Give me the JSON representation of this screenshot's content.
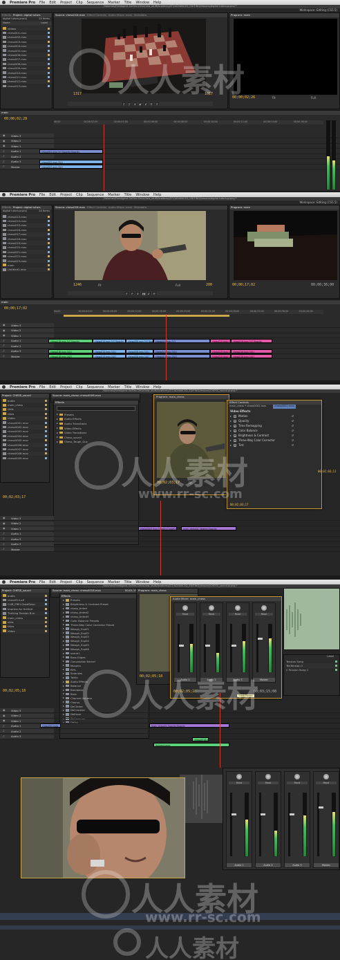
{
  "menu": {
    "apple_icon": "apple-icon",
    "app": "Premiere Pro",
    "items": [
      "File",
      "Edit",
      "Project",
      "Clip",
      "Sequence",
      "Marker",
      "Title",
      "Window",
      "Help"
    ]
  },
  "workspace": "Workspace:",
  "workspace_value": "Editing (CS5.5)",
  "s1": {
    "path": "/Volumes/FreeAgent GoFlex Drive/raw_stuff/Academy/DT/ADVANCED_EDITING/lessons/digital tutors.prproj *",
    "project_tabs": [
      "Effects",
      "Project: digital tutors"
    ],
    "project_name": "digital tutors.prproj",
    "items_count": "24 Items",
    "columns": [
      "Name",
      "Label"
    ],
    "files": [
      "videos",
      "chess001.mov",
      "chess002.mov",
      "chess003.mov",
      "chess004.mov",
      "chess005.mov",
      "chess006.mov",
      "chess007.mov",
      "chess008.mov",
      "chess009.mov",
      "chess010.mov",
      "chess011.mov",
      "chess012.mov",
      "chess013.mov"
    ],
    "source_tabs": [
      "Source: chess018.mov",
      "Effect Controls",
      "Audio Mixer: main",
      "Metadata"
    ],
    "program_tab": "Program: main",
    "source_tc_in": "1317",
    "source_tc_out": "1017",
    "program_tc": "00;00;02;26",
    "fit": "Fit",
    "full": "Full",
    "seq_tab": "main",
    "seq_tc": "00;00;02;28",
    "ruler": [
      "00;00",
      "00;00;02;00",
      "00;00;04;00",
      "00;00;06;00",
      "00;00;08;00",
      "00;00;10;00",
      "00;00;12;00",
      "00;00;14;00",
      "00;00;16;00"
    ],
    "tracks": [
      "Video 3",
      "Video 2",
      "Video 1",
      "Audio 1",
      "Audio 2",
      "Audio 3",
      "Master"
    ],
    "clips": [
      "chess002.mov [V]  Opacity:Opacity",
      "chess002.mov [A1]",
      "chess002.mov [A2]"
    ]
  },
  "s2": {
    "path": "/Volumes/FreeAgent GoFlex Drive/raw_stuff/Academy/DT/ADVANCED_EDITING/lessons/digital tutors.prproj *",
    "project_tabs": [
      "Effects",
      "Project: digital tutors"
    ],
    "project_name": "digital tutors.prproj",
    "items_count": "24 Items",
    "files": [
      "chess013.mov",
      "chess014.mov",
      "chess015.mov",
      "chess016.mov",
      "chess017.mov",
      "chess018.mov",
      "chess019.mov",
      "chess020.mov",
      "chess021.mov",
      "chess022.mov",
      "chess023.mov",
      "main",
      "Untitled1.mov"
    ],
    "source_tabs": [
      "Source: chess018.mov",
      "Effect Controls",
      "Audio Mixer: main",
      "Metadata"
    ],
    "program_tab": "Program: main",
    "source_tc_in": "1246",
    "source_tc_out": "200",
    "program_tc": "00;00;17;02",
    "program_tc_end": "00;00;36;00",
    "fit": "Fit",
    "full": "Full",
    "seq_tab": "main",
    "seq_tc": "00;00;17;02",
    "ruler": [
      "00;00",
      "00;00;04;00",
      "00;00;08;00",
      "00;00;12;00",
      "00;00;16;00",
      "00;00;20;00",
      "00;00;24;00",
      "00;00;28;00",
      "00;00;32;00",
      "00;00;36;00",
      "00;00;40;00"
    ],
    "tracks": [
      "Video 3",
      "Video 2",
      "Video 1",
      "Audio 1",
      "Audio 2",
      "Audio 3",
      "Master"
    ],
    "clips_green": [
      "chess018.mov [V]  Opacity",
      "chess018.mov [A1]",
      "chess018.mov [A2]"
    ],
    "clips_blue": [
      "chess014.mov [V]  Opacity",
      "chess014.mov [A1]",
      "chess014.mov [A2]"
    ],
    "clips_blue2": [
      "chess008.mov [V]  Opacity",
      "chess008.mov [A1]",
      "chess008.mov [A2]"
    ],
    "clips_blue3": [
      "chess001.mov [V]",
      "chess001.mov [A1]",
      "chess001.mov [A2]"
    ],
    "clips_pink": [
      "chess015.mov [V]  Opacity",
      "chess015.mov [A1]",
      "chess015.mov [A2]"
    ],
    "clips_pink2": [
      "chess016.mov [V]  Opacity",
      "chess016.mov [A1]",
      "chess016.mov [A2]"
    ]
  },
  "s3": {
    "path": "/Volumes/FreeAgent GoFlex Drive/raw_stuff/Academy/DT/ADVANCED_EDITING/lessons/CHESS_sound.prproj *",
    "project_tab": "Project: CHESS_sound",
    "source_tab": "Source: main_chess: chess0008.mov",
    "files": [
      "audio",
      "main_chess",
      "stills",
      "titles",
      "Video",
      "chess0001.mov",
      "chess0002.mov",
      "chess0003.mov",
      "chess0004.mov",
      "chess0005.mov",
      "chess0006.mov",
      "chess0007.mov",
      "chess0008.mov",
      "chess0009.mov"
    ],
    "effects_tab": "Effects",
    "effects": [
      "Presets",
      "Audio Effects",
      "Audio Transitions",
      "Video Effects",
      "Video Transitions",
      "Chess_sound",
      "Chess_Tough_Guy"
    ],
    "program_tab": "Program: main_chess",
    "program_tc": "00;02;03;17",
    "fit": "Fit",
    "seq_tc": "00;02;03;17",
    "fx_tab": "Effect Controls",
    "fx_clip": "main_chess * chess0002.mov",
    "fx_clip_chip": "chess0002.mov",
    "fx_section": "Video Effects",
    "fx_items": [
      "Motion",
      "Opacity",
      "Time Remapping",
      "Color Balance",
      "Brightness & Contrast",
      "Three-Way Color Corrector",
      "Tint"
    ],
    "fx_tc": "00;02;03;17",
    "seq_tc_right": "00;02;03;11",
    "tracks": [
      "Video 3",
      "Video 2",
      "Video 1",
      "Audio 1",
      "Audio 2",
      "Audio 3",
      "Master"
    ],
    "clips": [
      "chess0002.mov  Opacity:Opacity",
      "main_chess01_Nested  Opacity"
    ]
  },
  "s4": {
    "path": "/Volumes/FreeAgent GoFlex Drive/raw_stuff/Academy/DT/ADVANCED_EDITING/lessons/CHESS_sound.prproj *",
    "project_tab": "Project: CHESS_sound",
    "source_tab": "Source: main_chess: chess0018.mov",
    "source_tc": "00;01;15;08",
    "files": [
      "audio",
      "chess014.aif",
      "CLIR_FREI-GoodSoun",
      "Impress for thrilled",
      "Thrilling Tension B.m",
      "main_chess",
      "stills",
      "titles",
      "Video"
    ],
    "effects_tab": "Effects",
    "effects": [
      "Presets",
      "Brightness & Contrast Preset",
      "chess_tinted",
      "chess_tinted2",
      "chess_tinted3",
      "Color Balance Presets",
      "Three-Way Color Corrector Preset",
      "Waugh_Exp01",
      "Waugh_Exp02",
      "Waugh_Exp03",
      "Waugh_Exp04",
      "Waugh_Exp05",
      "Waugh_Exp06",
      "scene1",
      "Bass Edges",
      "Convolution Kernel",
      "Mosaics",
      "PIPs",
      "Solarizes",
      "Twirls",
      "Audio Effects",
      "Balance",
      "Bandpass",
      "Bass",
      "Channel Volume",
      "Chorus",
      "DeClicker",
      "DeCrackler",
      "DeEsser",
      "DeHummer",
      "Delay"
    ],
    "program_tab": "Program: main_chess",
    "program_tc": "00;02;05;18",
    "mixer_tab": "Audio Mixer: main_chess",
    "mixer_channels": [
      "Audio 1",
      "Audio 2",
      "Audio 3",
      "Master"
    ],
    "mixer_read": "Read",
    "mixer_tc": "00;02;05;18",
    "mixer_tc_end": "00;03;15;08",
    "track_name_tooltip": "Track Name",
    "bin_items": [
      "Tension Song",
      "TenTension 1",
      "n Tension Song 1"
    ],
    "label_col": "Label",
    "seq_tc": "00;02;05;18",
    "tracks": [
      "Video 3",
      "Video 2",
      "Video 1",
      "Audio 1",
      "Audio 2",
      "Audio 3"
    ],
    "clips": [
      "chess002.mov",
      "main_chess01 Opacity:Opacity",
      "Volume:Level",
      "chess0018.mov"
    ]
  },
  "watermarks": {
    "brand": "人人素材",
    "url": "www.rr-sc.com"
  },
  "colors": {
    "accent": "#f0c040",
    "playhead": "#d23b2b",
    "clip_video": "#7b8fd0",
    "clip_green": "#5ed27a",
    "clip_pink": "#e35aa8",
    "clip_purple": "#a678d6",
    "float_border": "#c99830"
  }
}
